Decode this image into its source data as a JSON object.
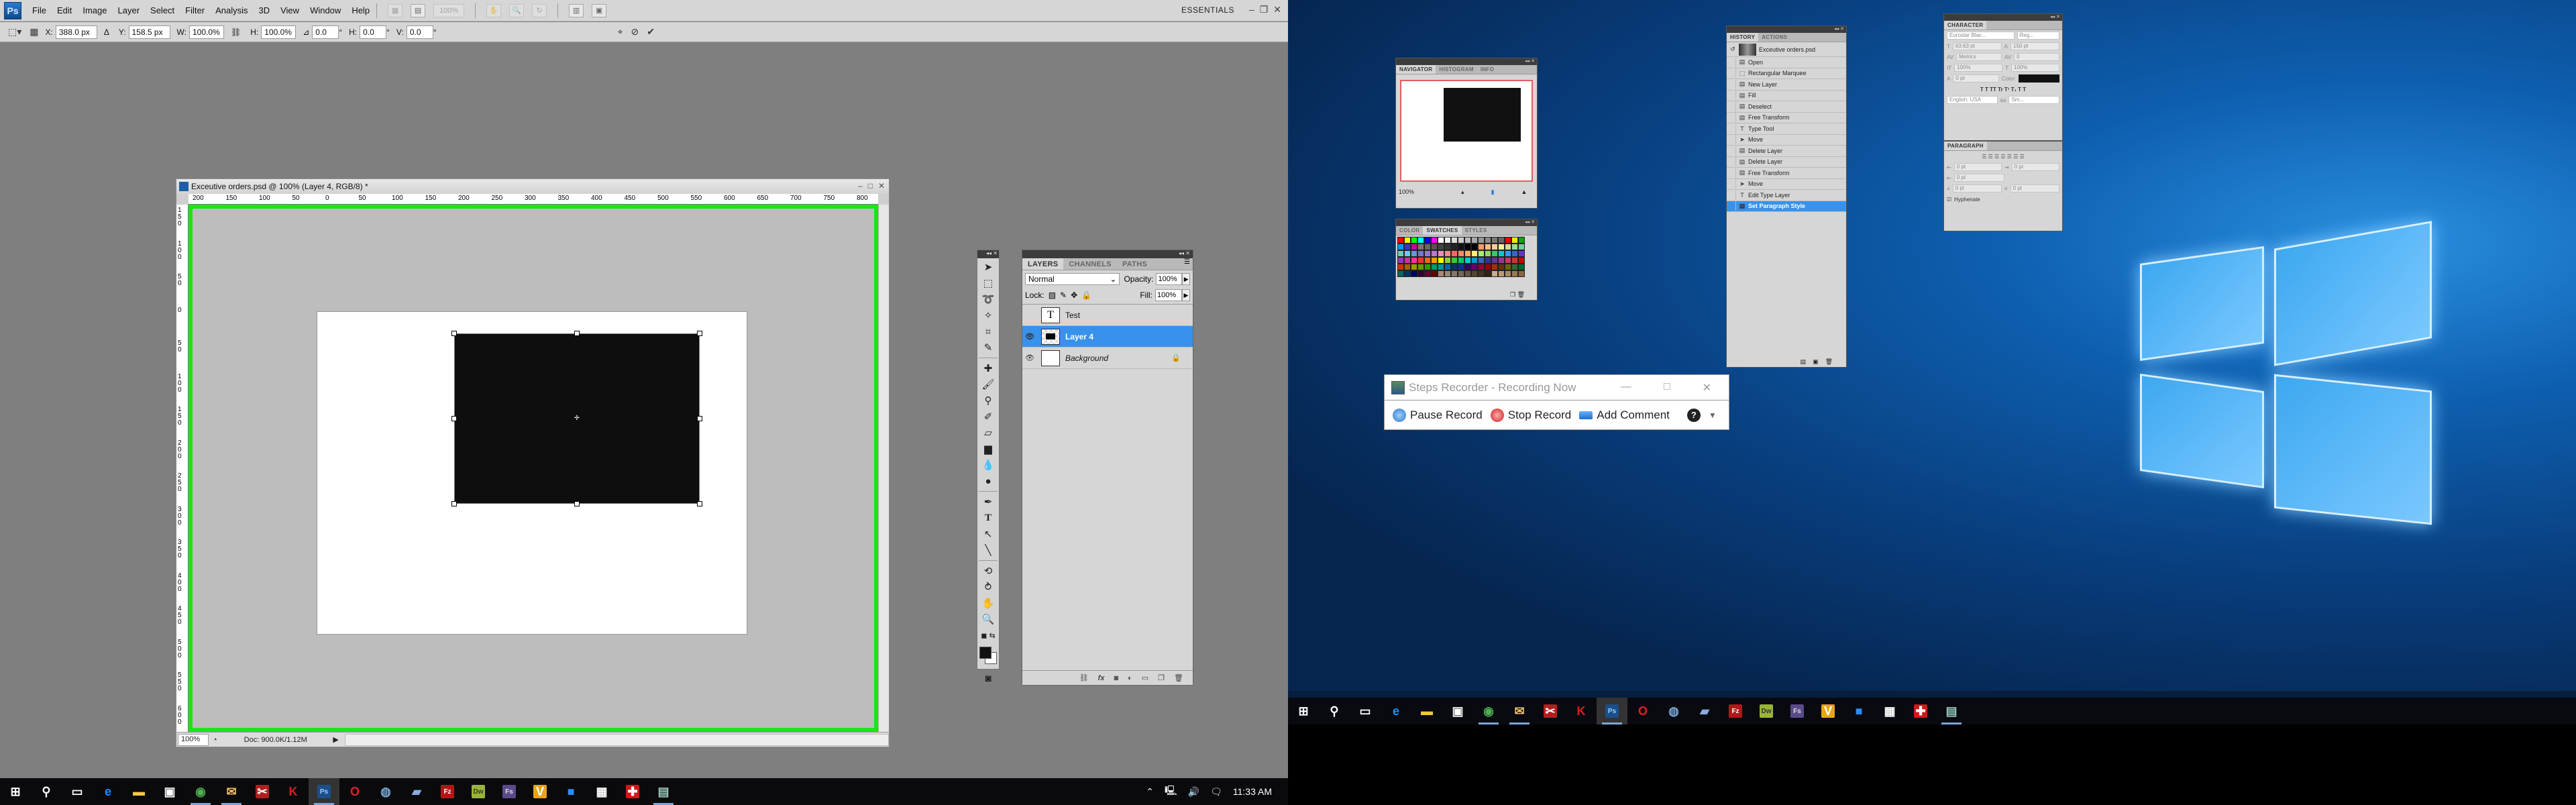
{
  "photoshop": {
    "menu": [
      "File",
      "Edit",
      "Image",
      "Layer",
      "Select",
      "Filter",
      "Analysis",
      "3D",
      "View",
      "Window",
      "Help"
    ],
    "logo": "Ps",
    "zoom_menu": "100%",
    "workspace": "ESSENTIALS",
    "options": {
      "x_label": "X:",
      "x_value": "388.0 px",
      "y_label": "Y:",
      "y_value": "158.5 px",
      "w_label": "W:",
      "w_value": "100.0%",
      "h_label": "H:",
      "h_value": "100.0%",
      "angle_value": "0.0",
      "hskew_label": "H:",
      "hskew_value": "0.0",
      "vskew_label": "V:",
      "vskew_value": "0.0",
      "degree": "°"
    },
    "document": {
      "title": "Exceutive orders.psd @ 100% (Layer 4, RGB/8) *",
      "ruler_h": [
        "200",
        "150",
        "100",
        "50",
        "0",
        "50",
        "100",
        "150",
        "200",
        "250",
        "300",
        "350",
        "400",
        "450",
        "500",
        "550",
        "600",
        "650",
        "700",
        "750",
        "800"
      ],
      "ruler_v": [
        "150",
        "100",
        "50",
        "0",
        "50",
        "100",
        "150",
        "200",
        "250",
        "300",
        "350",
        "400",
        "450",
        "500",
        "550",
        "600"
      ],
      "zoom": "100%",
      "doc_info": "Doc: 900.0K/1.12M"
    },
    "layers_panel": {
      "tabs": [
        "LAYERS",
        "CHANNELS",
        "PATHS"
      ],
      "blend_mode": "Normal",
      "opacity_label": "Opacity:",
      "opacity": "100%",
      "lock_label": "Lock:",
      "fill_label": "Fill:",
      "fill": "100%",
      "layers": [
        {
          "name": "Test",
          "type": "text",
          "visible": false,
          "selected": false
        },
        {
          "name": "Layer 4",
          "type": "raster",
          "visible": true,
          "selected": true
        },
        {
          "name": "Background",
          "type": "background",
          "visible": true,
          "selected": false,
          "locked": true
        }
      ]
    }
  },
  "floating_panels": {
    "navigator": {
      "tabs": [
        "NAVIGATOR",
        "HISTOGRAM",
        "INFO"
      ],
      "zoom": "100%"
    },
    "swatches": {
      "tabs": [
        "COLOR",
        "SWATCHES",
        "STYLES"
      ]
    },
    "history": {
      "tabs": [
        "HISTORY",
        "ACTIONS"
      ],
      "snapshot": "Exceutive orders.psd",
      "items": [
        "Open",
        "Rectangular Marquee",
        "New Layer",
        "Fill",
        "Deselect",
        "Free Transform",
        "Type Tool",
        "Move",
        "Delete Layer",
        "Delete Layer",
        "Free Transform",
        "Move",
        "Edit Type Layer",
        "Set Paragraph Style"
      ],
      "selected": "Set Paragraph Style"
    },
    "character": {
      "title": "CHARACTER",
      "font": "Eurostar Blac...",
      "style": "Reg...",
      "size": "63.63 pt",
      "leading": "150 pt",
      "kerning": "Metrics",
      "tracking": "0",
      "vscale": "100%",
      "hscale": "100%",
      "baseline": "0 pt",
      "color_label": "Color:",
      "language": "English: USA",
      "antialias": "Sm..."
    },
    "paragraph": {
      "title": "PARAGRAPH",
      "indent_left": "0 pt",
      "indent_right": "0 pt",
      "indent_first": "0 pt",
      "space_before": "0 pt",
      "space_after": "0 pt",
      "hyphenate_label": "Hyphenate",
      "hyphenate": true
    }
  },
  "steps_recorder": {
    "title": "Steps Recorder - Recording Now",
    "pause": "Pause Record",
    "stop": "Stop Record",
    "comment": "Add Comment"
  },
  "taskbar_left": {
    "apps": [
      "start",
      "search",
      "task-view",
      "edge",
      "file-explorer",
      "store",
      "chrome",
      "outlook",
      "xmind",
      "kaspersky",
      "photoshop",
      "opera",
      "app-globe",
      "notepad",
      "filezilla",
      "dreamweaver",
      "fireworks",
      "app-v",
      "zoom",
      "calculator",
      "app-red",
      "steps-recorder"
    ],
    "active": "photoshop",
    "time": "11:33 AM"
  },
  "taskbar_right": {
    "apps": [
      "start",
      "search",
      "task-view",
      "edge",
      "file-explorer",
      "store",
      "chrome",
      "outlook",
      "xmind",
      "kaspersky",
      "photoshop",
      "opera",
      "app-globe",
      "notepad",
      "filezilla",
      "dreamweaver",
      "fireworks",
      "app-v",
      "zoom",
      "calculator",
      "app-red",
      "steps-recorder"
    ],
    "active": "photoshop"
  }
}
